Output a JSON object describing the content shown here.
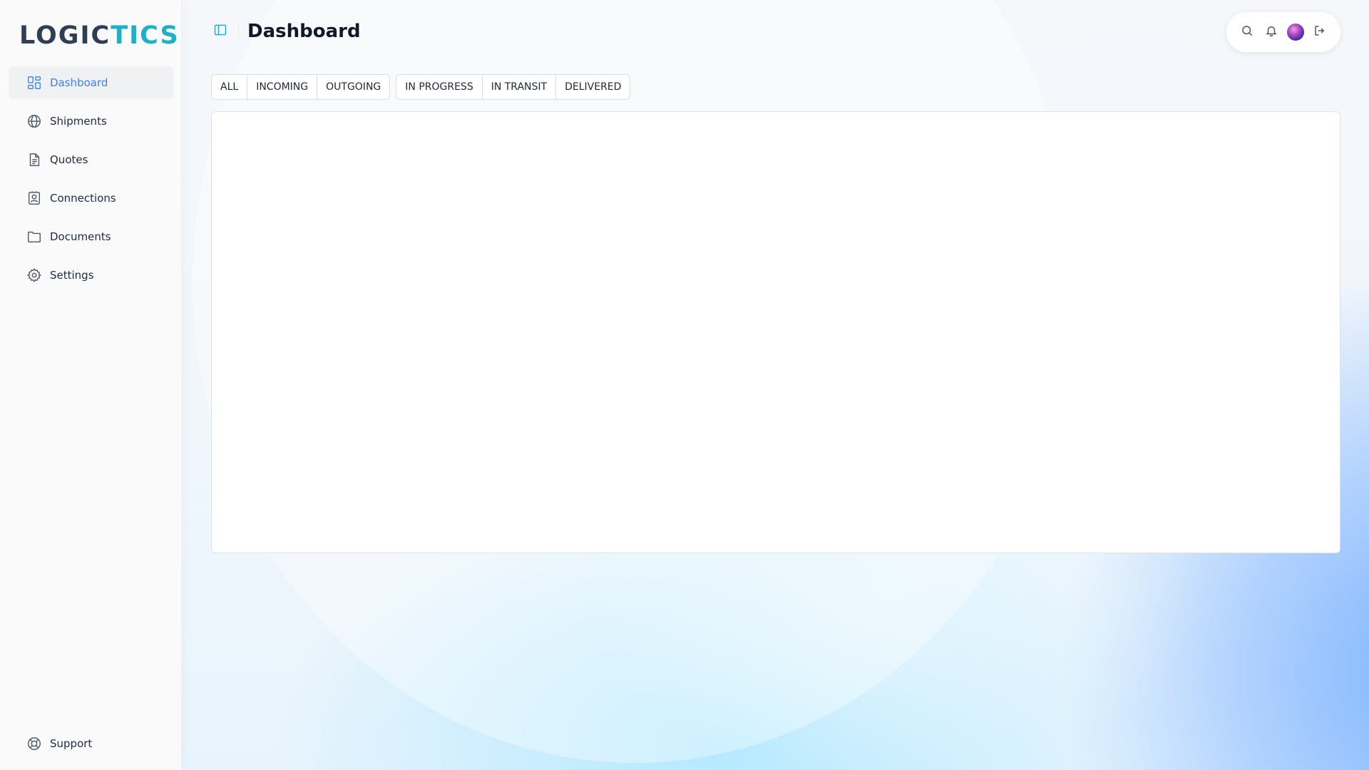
{
  "app": {
    "logo_part1": "LOGIC",
    "logo_part2": "TICS"
  },
  "sidebar": {
    "items": [
      {
        "label": "Dashboard",
        "icon": "dashboard-grid-icon",
        "active": true
      },
      {
        "label": "Shipments",
        "icon": "globe-icon",
        "active": false
      },
      {
        "label": "Quotes",
        "icon": "document-icon",
        "active": false
      },
      {
        "label": "Connections",
        "icon": "contact-card-icon",
        "active": false
      },
      {
        "label": "Documents",
        "icon": "folder-icon",
        "active": false
      },
      {
        "label": "Settings",
        "icon": "gear-icon",
        "active": false
      }
    ],
    "support_label": "Support"
  },
  "header": {
    "title": "Dashboard"
  },
  "filters": {
    "direction": [
      "ALL",
      "INCOMING",
      "OUTGOING"
    ],
    "status": [
      "IN PROGRESS",
      "IN TRANSIT",
      "DELIVERED"
    ]
  },
  "colors": {
    "accent": "#3b82f6",
    "brand": "#1fb0c6",
    "logo_dark": "#2f3e55"
  }
}
